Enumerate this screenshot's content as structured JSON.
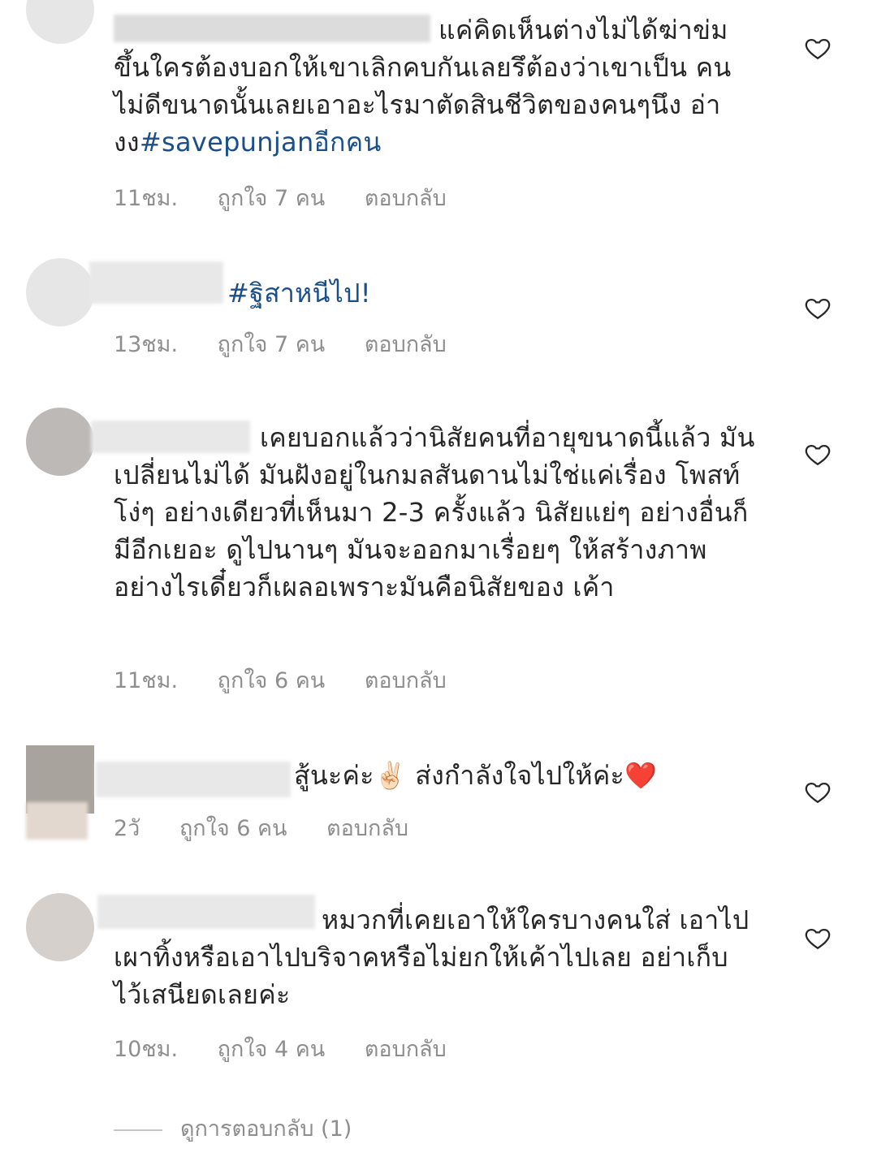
{
  "comments": [
    {
      "text": "แค่คิดเห็นต่างไม่ได้ฆ่าข่ม ขึ้นใครต้องบอกให้เขาเลิกคบกันเลยรึต้องว่าเขาเป็น คนไม่ดีขนาดนั้นเลยเอาอะไรมาตัดสินชีวิตของคนๆนึง อ่า งง",
      "hashtag": "#savepunjanอีกคน",
      "time": "11ชม.",
      "likes": "ถูกใจ 7 คน",
      "reply": "ตอบกลับ"
    },
    {
      "text": "",
      "hashtag": "#ฐิสาหนีไป!",
      "time": "13ชม.",
      "likes": "ถูกใจ 7 คน",
      "reply": "ตอบกลับ"
    },
    {
      "text": "เคยบอกแล้วว่านิสัยคนที่อายุขนาดนี้แล้ว มันเปลี่ยนไม่ได้ มันฝังอยู่ในกมลสันดานไม่ใช่แค่เรื่อง โพสท์โง่ๆ อย่างเดียวที่เห็นมา 2-3 ครั้งแล้ว นิสัยแย่ๆ อย่างอื่นก็มีอีกเยอะ ดูไปนานๆ มันจะออกมาเรื่อยๆ ให้สร้างภาพอย่างไรเดี๋ยวก็เผลอเพราะมันคือนิสัยของ เค้า",
      "hashtag": "",
      "time": "11ชม.",
      "likes": "ถูกใจ 6 คน",
      "reply": "ตอบกลับ"
    },
    {
      "text": "สู้นะค่ะ✌🏻 ส่งกำลังใจไปให้ค่ะ❤️",
      "hashtag": "",
      "time": "2วั",
      "likes": "ถูกใจ 6 คน",
      "reply": "ตอบกลับ"
    },
    {
      "text": "หมวกที่เคยเอาให้ใครบางคนใส่ เอาไปเผาทิ้งหรือเอาไปบริจาคหรือไม่ยกให้เค้าไปเลย อย่าเก็บไว้เสนียดเลยค่ะ",
      "hashtag": "",
      "time": "10ชม.",
      "likes": "ถูกใจ 4 คน",
      "reply": "ตอบกลับ"
    }
  ],
  "view_replies": "ดูการตอบกลับ (1)",
  "icons": {
    "like": "heart-outline-icon"
  },
  "colors": {
    "hashtag": "#1a4f8a",
    "meta": "#8e8e8e",
    "text": "#262626"
  }
}
